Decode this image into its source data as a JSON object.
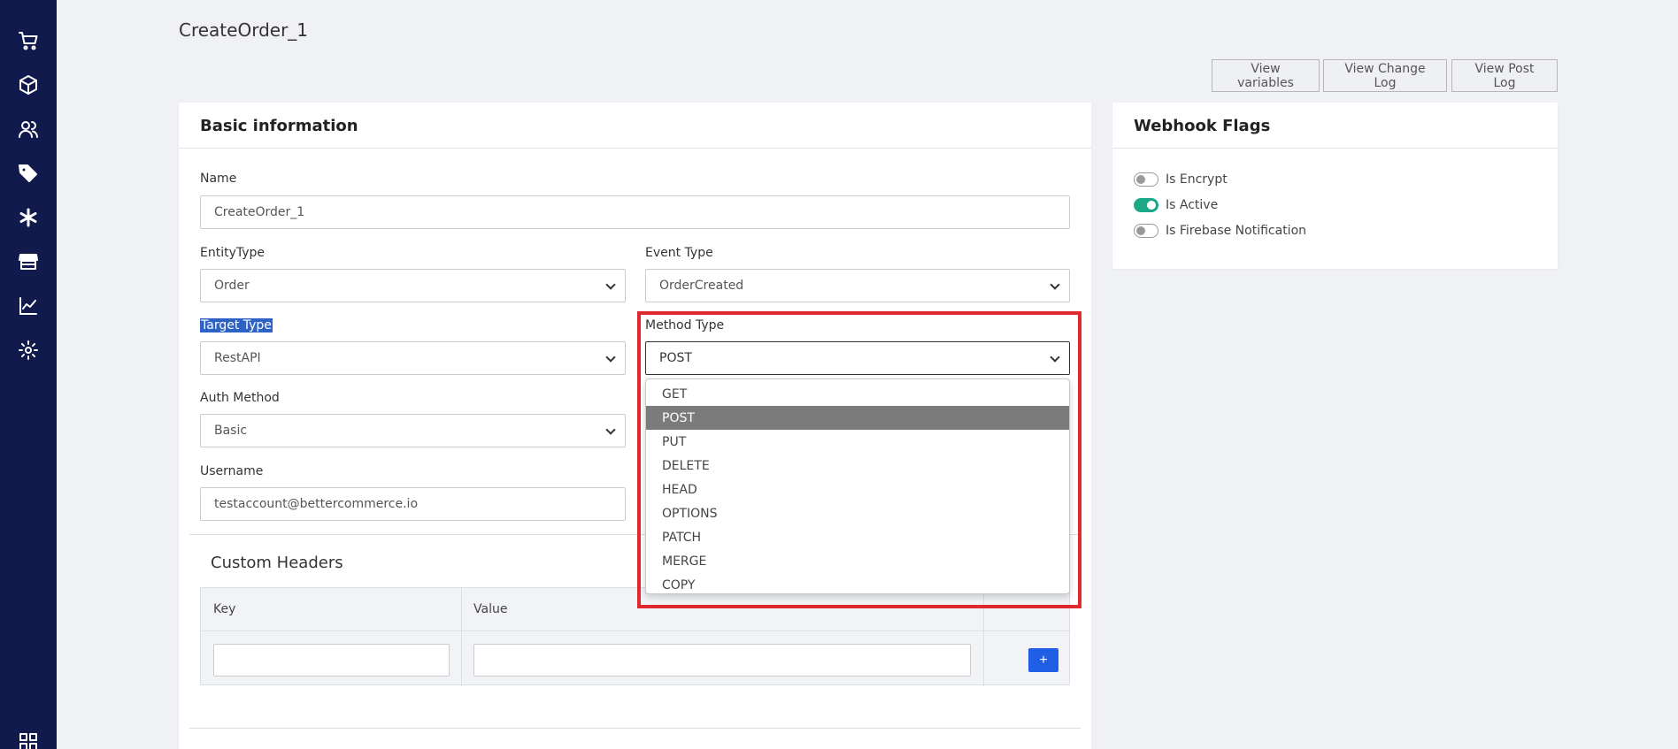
{
  "page": {
    "title": "CreateOrder_1"
  },
  "sidebar": {
    "icons": [
      "cart-icon",
      "box-icon",
      "users-icon",
      "tags-icon",
      "asterisk-icon",
      "store-icon",
      "chart-icon",
      "gear-icon",
      "grid-icon"
    ]
  },
  "toolbar": {
    "view_variables": "View variables",
    "view_change_log": "View Change Log",
    "view_post_log": "View Post Log"
  },
  "basic": {
    "heading": "Basic information",
    "name_label": "Name",
    "name_value": "CreateOrder_1",
    "entity_type_label": "EntityType",
    "entity_type_value": "Order",
    "event_type_label": "Event Type",
    "event_type_value": "OrderCreated",
    "target_type_label": "Target Type",
    "target_type_value": "RestAPI",
    "method_type_label": "Method Type",
    "method_type_value": "POST",
    "auth_method_label": "Auth Method",
    "auth_method_value": "Basic",
    "username_label": "Username",
    "username_value": "testaccount@bettercommerce.io"
  },
  "headers": {
    "title": "Custom Headers",
    "key_col": "Key",
    "value_col": "Value",
    "add_label": "+"
  },
  "method_dropdown": {
    "options": [
      "GET",
      "POST",
      "PUT",
      "DELETE",
      "HEAD",
      "OPTIONS",
      "PATCH",
      "MERGE",
      "COPY"
    ],
    "selected": "POST"
  },
  "flags": {
    "heading": "Webhook Flags",
    "items": [
      {
        "label": "Is Encrypt",
        "on": false
      },
      {
        "label": "Is Active",
        "on": true
      },
      {
        "label": "Is Firebase Notification",
        "on": false
      }
    ]
  },
  "colors": {
    "sidebar": "#111a4c",
    "accent": "#1f5fe6",
    "toggle_on": "#1aa886",
    "highlight": "#e0292f",
    "selection": "#2f62c5"
  }
}
